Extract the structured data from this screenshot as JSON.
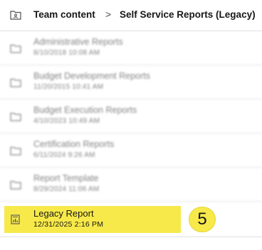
{
  "breadcrumb": {
    "root": "Team content",
    "separator": ">",
    "current": "Self Service Reports (Legacy)"
  },
  "items": [
    {
      "name": "Administrative Reports",
      "date": "8/10/2018 10:08 AM",
      "type": "folder-icon"
    },
    {
      "name": "Budget Development Reports",
      "date": "11/20/2015 10:41 AM",
      "type": "folder-icon"
    },
    {
      "name": "Budget Execution Reports",
      "date": "4/10/2023 10:49 AM",
      "type": "folder-icon"
    },
    {
      "name": "Certification Reports",
      "date": "6/11/2024 9:26 AM",
      "type": "folder-icon"
    },
    {
      "name": "Report Template",
      "date": "8/29/2024 11:06 AM",
      "type": "folder-icon"
    },
    {
      "name": "Legacy Report",
      "date": "12/31/2025 2:16 PM",
      "type": "report-icon"
    }
  ],
  "step_badge": "5",
  "colors": {
    "highlight": "#f7e94a",
    "divider": "#e0e0e0",
    "text": "#161616",
    "muted": "#6f6f6f"
  }
}
